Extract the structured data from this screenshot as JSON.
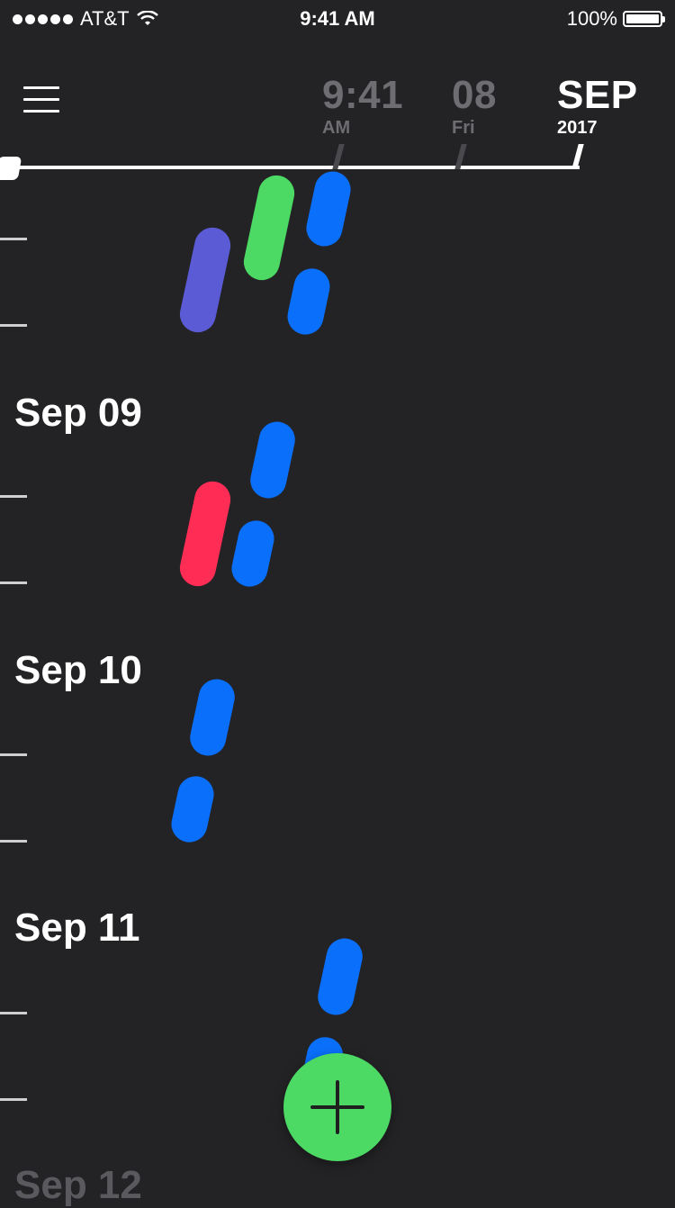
{
  "status_bar": {
    "carrier": "AT&T",
    "time": "9:41 AM",
    "battery": "100%"
  },
  "header": {
    "time": "9:41",
    "ampm": "AM",
    "day_number": "08",
    "weekday": "Fri",
    "month": "SEP",
    "year": "2017"
  },
  "days": [
    {
      "label": "Sep 09"
    },
    {
      "label": "Sep 10"
    },
    {
      "label": "Sep 11"
    },
    {
      "label": "Sep 12"
    }
  ],
  "colors": {
    "background": "#232326",
    "blue": "#0a6ffa",
    "green": "#4cd964",
    "purple": "#5b5bd6",
    "red": "#ff2d55",
    "fab": "#4cd964"
  },
  "icons": [
    "menu-icon",
    "wifi-icon",
    "battery-icon",
    "plus-icon"
  ]
}
